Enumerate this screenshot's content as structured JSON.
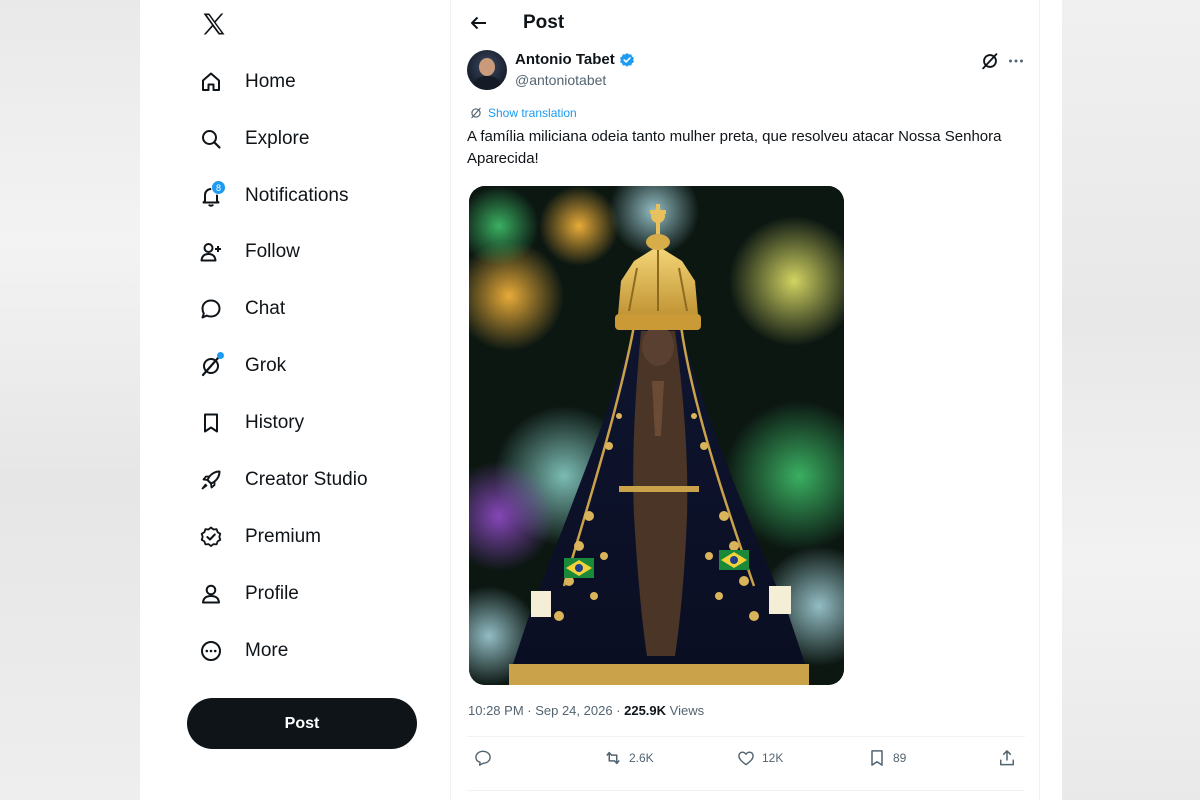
{
  "sidebar": {
    "logo": "x-logo-icon",
    "items": [
      {
        "label": "Home",
        "icon": "home-icon"
      },
      {
        "label": "Explore",
        "icon": "search-icon"
      },
      {
        "label": "Notifications",
        "icon": "bell-icon",
        "badge": "8"
      },
      {
        "label": "Follow",
        "icon": "add-person-icon"
      },
      {
        "label": "Chat",
        "icon": "chat-bubble-icon"
      },
      {
        "label": "Grok",
        "icon": "grok-icon"
      },
      {
        "label": "History",
        "icon": "bookmark-icon"
      },
      {
        "label": "Creator Studio",
        "icon": "rocket-icon"
      },
      {
        "label": "Premium",
        "icon": "verified-badge-icon"
      },
      {
        "label": "Profile",
        "icon": "person-icon"
      },
      {
        "label": "More",
        "icon": "more-circle-icon"
      }
    ],
    "post_button": "Post"
  },
  "header": {
    "title": "Post"
  },
  "tweet": {
    "author_name": "Antonio Tabet",
    "author_handle": "@antoniotabet",
    "show_translation": "Show translation",
    "text": "A família miliciana odeia tanto mulher preta, que resolveu atacar Nossa Senhora Aparecida!",
    "time": "10:28 PM · Sep 24, 2026",
    "separator": " · ",
    "views_count": "225.9K",
    "views_label": " Views",
    "replies": "",
    "reposts": "2.6K",
    "likes": "12K",
    "bookmarks": "89"
  },
  "colors": {
    "accent": "#1d9bf0",
    "text": "#0f1419",
    "muted": "#536471",
    "button": "#0f1419"
  }
}
